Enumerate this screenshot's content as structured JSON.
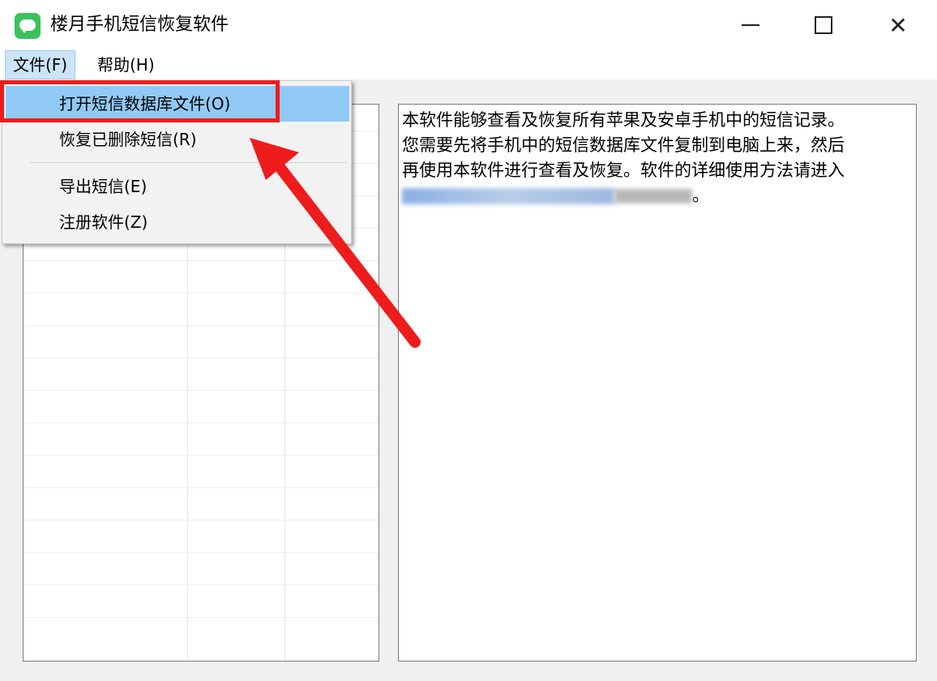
{
  "window": {
    "title": "楼月手机短信恢复软件",
    "controls": {
      "minimize": "",
      "maximize": "",
      "close": "✕"
    }
  },
  "menubar": {
    "items": [
      {
        "label": "文件(F)"
      },
      {
        "label": "帮助(H)"
      }
    ]
  },
  "file_menu": {
    "items": [
      {
        "label": "打开短信数据库文件(O)",
        "highlighted": true
      },
      {
        "label": "恢复已删除短信(R)"
      },
      {
        "label": "导出短信(E)"
      },
      {
        "label": "注册软件(Z)"
      }
    ]
  },
  "info": {
    "line1": "本软件能够查看及恢复所有苹果及安卓手机中的短信记录。",
    "line2": "您需要先将手机中的短信数据库文件复制到电脑上来，然后",
    "line3": "再使用本软件进行查看及恢复。软件的详细使用方法请进入",
    "line4_end": "。"
  },
  "colors": {
    "menu_highlight": "#91c9f7",
    "annotation": "#ee1c1c",
    "app_icon": "#39c15c"
  }
}
